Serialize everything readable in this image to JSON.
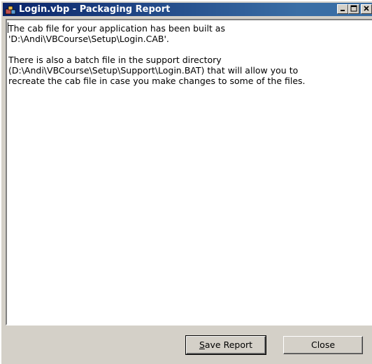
{
  "window": {
    "title": "Login.vbp - Packaging Report",
    "app_icon": "vb-package-icon",
    "controls": {
      "minimize": "minimize-icon",
      "maximize": "maximize-icon",
      "close": "close-icon"
    }
  },
  "report": {
    "text": "The cab file for your application has been built as\n'D:\\Andi\\VBCourse\\Setup\\Login.CAB'.\n\nThere is also a batch file in the support directory\n(D:\\Andi\\VBCourse\\Setup\\Support\\Login.BAT) that will allow you to\nrecreate the cab file in case you make changes to some of the files."
  },
  "buttons": {
    "save_mnemonic": "S",
    "save_rest": "ave Report",
    "close_label": "Close"
  }
}
